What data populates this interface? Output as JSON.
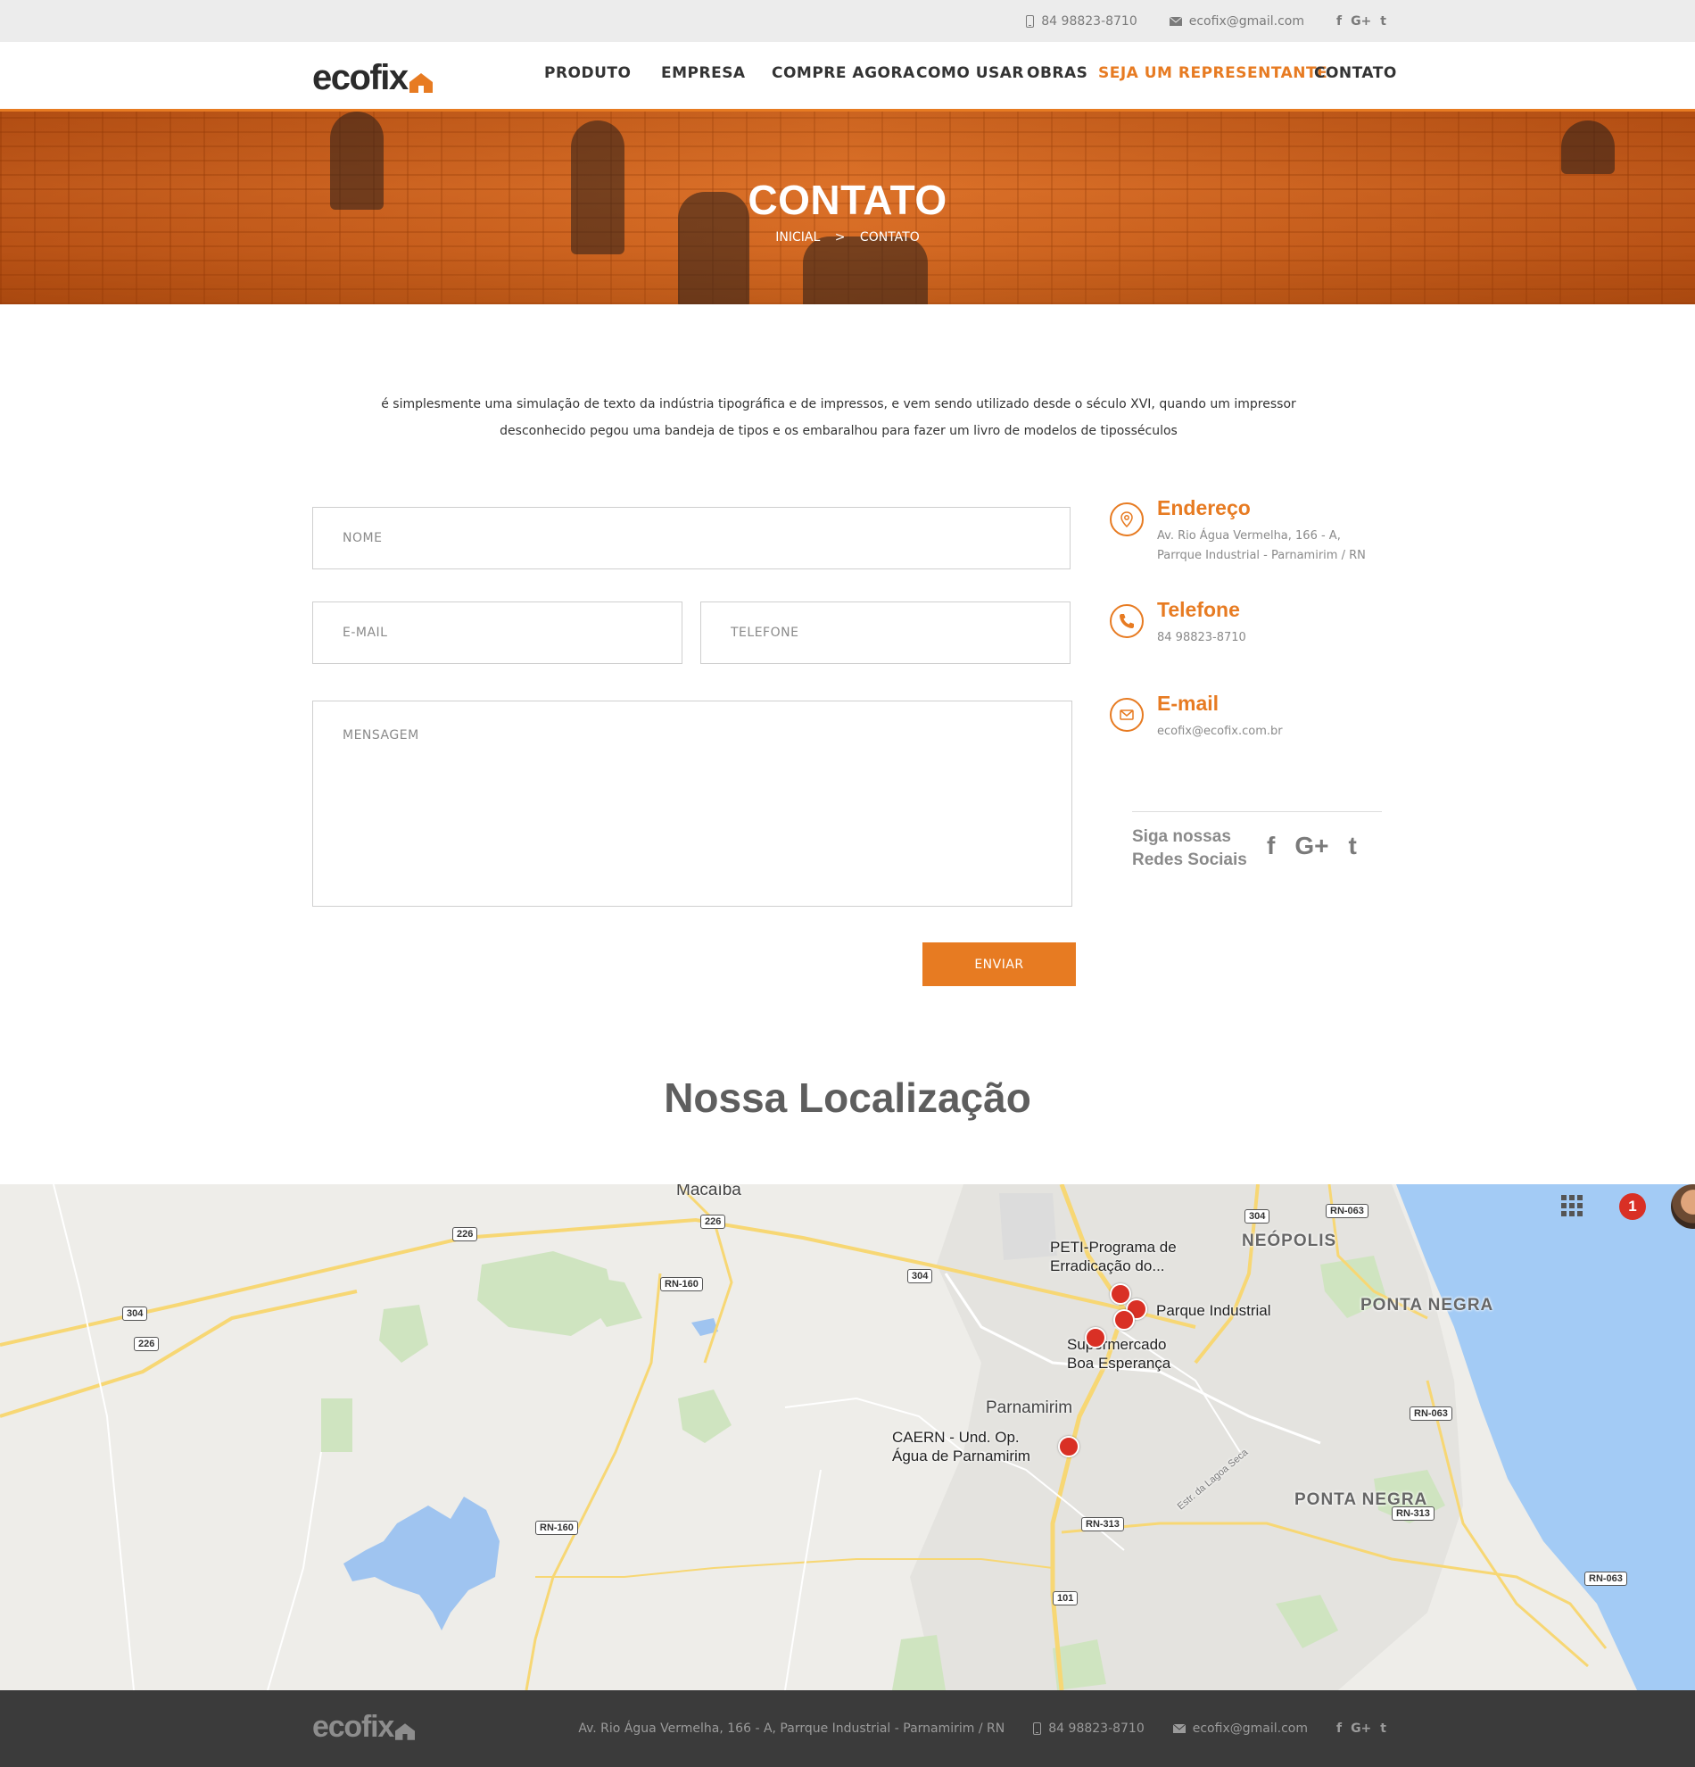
{
  "topbar": {
    "phone": "84 98823-8710",
    "email": "ecofix@gmail.com",
    "social": [
      "f",
      "G+",
      "t"
    ]
  },
  "header": {
    "logo": "ecofix",
    "nav": [
      {
        "label": "PRODUTO",
        "accent": false
      },
      {
        "label": "EMPRESA",
        "accent": false
      },
      {
        "label": "COMPRE AGORA",
        "accent": false
      },
      {
        "label": "COMO USAR",
        "accent": false
      },
      {
        "label": "OBRAS",
        "accent": false
      },
      {
        "label": "SEJA UM REPRESENTANTE",
        "accent": true
      },
      {
        "label": "CONTATO",
        "accent": false
      }
    ]
  },
  "hero": {
    "title": "CONTATO",
    "breadcrumb": {
      "home": "INICIAL",
      "sep": ">",
      "current": "CONTATO"
    }
  },
  "intro": {
    "line1": "é simplesmente uma simulação de texto da indústria tipográfica e de impressos, e vem sendo utilizado desde o século XVI, quando um impressor",
    "line2": "desconhecido pegou uma bandeja de tipos e os embaralhou para fazer um livro de modelos de tiposséculos"
  },
  "form": {
    "name_placeholder": "NOME",
    "email_placeholder": "E-MAIL",
    "phone_placeholder": "TELEFONE",
    "message_placeholder": "MENSAGEM",
    "submit_label": "ENVIAR"
  },
  "contact": {
    "address": {
      "title": "Endereço",
      "line1": "Av. Rio Água Vermelha, 166 - A,",
      "line2": "Parrque Industrial - Parnamirim / RN"
    },
    "phone": {
      "title": "Telefone",
      "value": "84 98823-8710"
    },
    "email": {
      "title": "E-mail",
      "value": "ecofix@ecofix.com.br"
    },
    "follow_line1": "Siga nossas",
    "follow_line2": "Redes Sociais",
    "social": [
      "f",
      "G+",
      "t"
    ]
  },
  "location": {
    "title": "Nossa Localização",
    "map": {
      "places": [
        "Macaíba",
        "NEÓPOLIS",
        "PONTA NEGRA",
        "PONTA NEGRA",
        "Parnamirim",
        "Estr. da Lagoa Seca"
      ],
      "pois": [
        {
          "line1": "PETI-Programa de",
          "line2": "Erradicação do..."
        },
        {
          "line1": "Parque Industrial",
          "line2": ""
        },
        {
          "line1": "Supermercado",
          "line2": "Boa Esperança"
        },
        {
          "line1": "CAERN - Und. Op.",
          "line2": "Água de Parnamirim"
        }
      ],
      "roads": [
        "226",
        "226",
        "304",
        "304",
        "304",
        "RN-160",
        "RN-160",
        "RN-063",
        "RN-063",
        "RN-063",
        "RN-313",
        "RN-313",
        "101",
        "226"
      ],
      "notification_count": "1"
    }
  },
  "footer": {
    "logo": "ecofix",
    "address": "Av. Rio Água Vermelha, 166 - A, Parrque Industrial - Parnamirim / RN",
    "phone": "84 98823-8710",
    "email": "ecofix@gmail.com",
    "social": [
      "f",
      "G+",
      "t"
    ]
  },
  "colors": {
    "accent": "#e77b22",
    "footer": "#3b3b3b",
    "topbar": "#ececec"
  }
}
